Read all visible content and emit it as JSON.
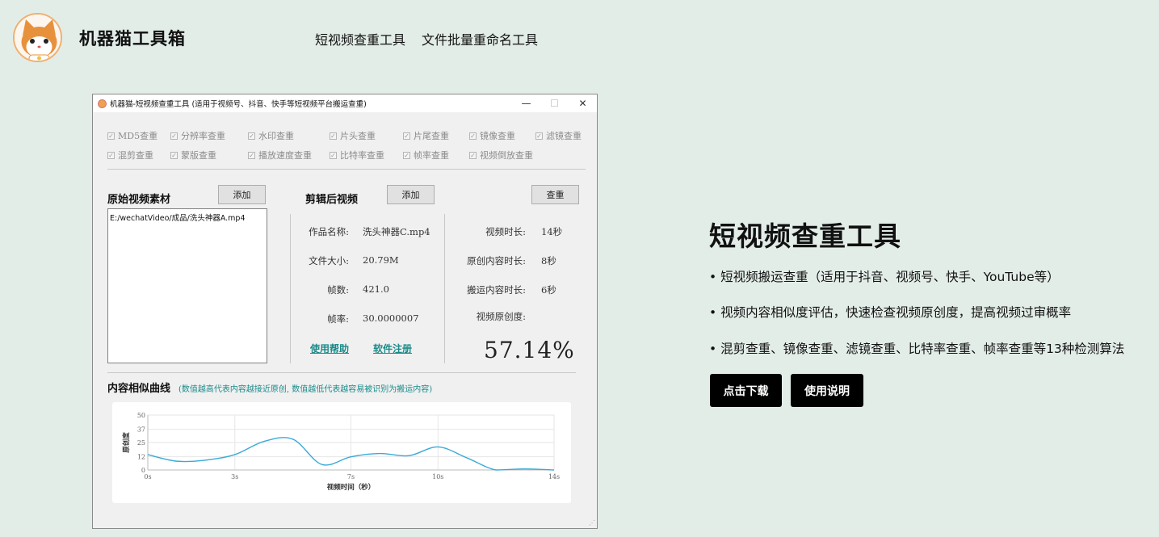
{
  "header": {
    "brand": "机器猫工具箱",
    "nav": [
      "短视频查重工具",
      "文件批量重命名工具"
    ]
  },
  "app": {
    "title": "机器猫-短视频查重工具 (适用于视频号、抖音、快手等短视频平台搬运查重)",
    "window_buttons": [
      "—",
      "☐",
      "✕"
    ],
    "checkboxes_row1": [
      "MD5查重",
      "分辨率查重",
      "水印查重",
      "片头查重",
      "片尾查重",
      "镜像查重",
      "滤镜查重"
    ],
    "checkboxes_row2": [
      "混剪查重",
      "蒙版查重",
      "播放速度查重",
      "比特率查重",
      "帧率查重",
      "视频倒放查重"
    ],
    "original": {
      "title": "原始视频素材",
      "add_label": "添加",
      "files": [
        "E:/wechatVideo/成品/洗头神器A.mp4"
      ]
    },
    "edited": {
      "title": "剪辑后视频",
      "add_label": "添加",
      "check_label": "查重",
      "fields": [
        {
          "label": "作品名称:",
          "value": "洗头神器C.mp4"
        },
        {
          "label": "文件大小:",
          "value": "20.79M"
        },
        {
          "label": "帧数:",
          "value": "421.0"
        },
        {
          "label": "帧率:",
          "value": "30.0000007"
        }
      ],
      "stats": [
        {
          "label": "视频时长:",
          "value": "14秒"
        },
        {
          "label": "原创内容时长:",
          "value": "8秒"
        },
        {
          "label": "搬运内容时长:",
          "value": "6秒"
        },
        {
          "label": "视频原创度:",
          "value": ""
        }
      ],
      "help_link": "使用帮助",
      "register_link": "软件注册",
      "originality": "57.14%"
    },
    "curve_title": "内容相似曲线",
    "curve_note": "(数值越高代表内容越接近原创, 数值越低代表越容易被识别为搬运内容)"
  },
  "chart_data": {
    "type": "line",
    "xlabel": "视频时间（秒）",
    "ylabel": "原创度",
    "xlim": [
      0,
      14
    ],
    "ylim": [
      0,
      50
    ],
    "x_ticks": [
      "0s",
      "3s",
      "7s",
      "10s",
      "14s"
    ],
    "y_ticks": [
      "50",
      "37",
      "25",
      "12",
      "0"
    ],
    "grid": true,
    "color": "#3aaad8",
    "x": [
      0,
      1,
      2,
      3,
      4,
      5,
      6,
      7,
      8,
      9,
      10,
      11,
      12,
      13,
      14
    ],
    "series": [
      {
        "values": [
          14,
          8,
          9,
          14,
          26,
          28,
          5,
          12,
          15,
          13,
          21,
          11,
          0,
          1,
          0
        ]
      }
    ]
  },
  "right": {
    "title": "短视频查重工具",
    "bullets": [
      "• 短视频搬运查重（适用于抖音、视频号、快手、YouTube等）",
      "• 视频内容相似度评估，快速检查视频原创度，提高视频过审概率",
      "• 混剪查重、镜像查重、滤镜查重、比特率查重、帧率查重等13种检测算法"
    ],
    "download_label": "点击下载",
    "manual_label": "使用说明"
  }
}
